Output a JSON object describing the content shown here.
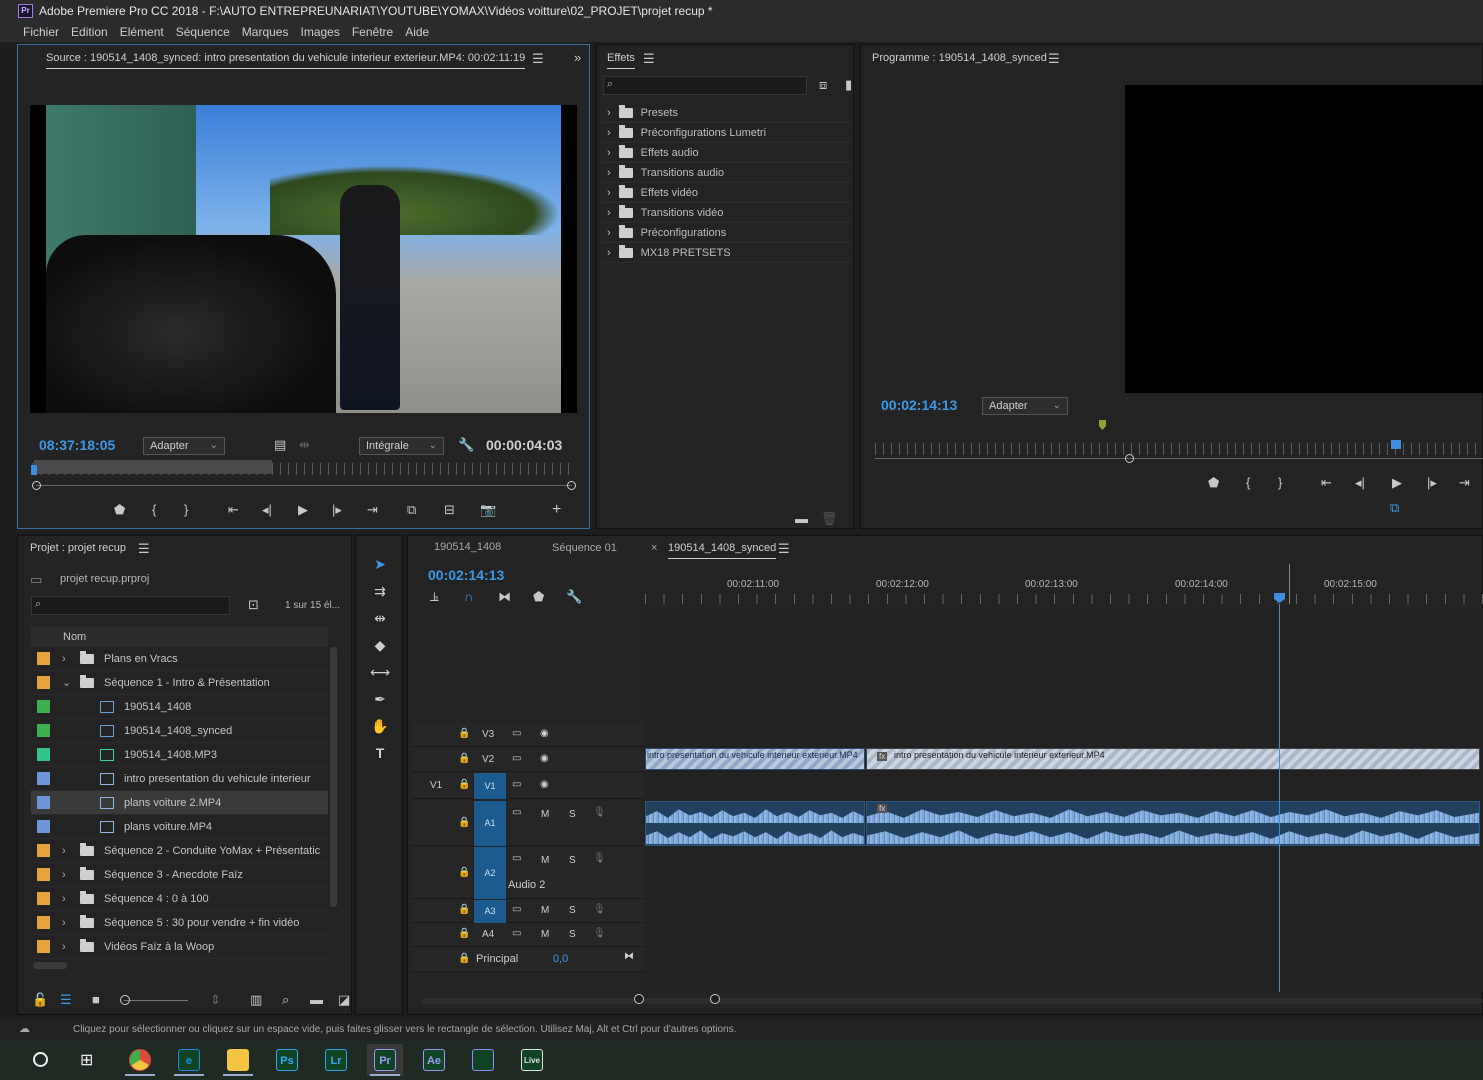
{
  "app": {
    "title": "Adobe Premiere Pro CC 2018 - F:\\AUTO ENTREPREUNARIAT\\YOUTUBE\\YOMAX\\Vidéos voitture\\02_PROJET\\projet recup *",
    "logo": "Pr"
  },
  "menu": [
    "Fichier",
    "Edition",
    "Elément",
    "Séquence",
    "Marques",
    "Images",
    "Fenêtre",
    "Aide"
  ],
  "source": {
    "title": "Source : 190514_1408_synced: intro  presentation du vehicule interieur exterieur.MP4: 00:02:11:19",
    "timecode": "08:37:18:05",
    "fit": "Adapter",
    "quality": "Intégrale",
    "duration": "00:00:04:03"
  },
  "effects": {
    "title": "Effets",
    "search_placeholder": "",
    "items": [
      "Presets",
      "Préconfigurations Lumetri",
      "Effets audio",
      "Transitions audio",
      "Effets vidéo",
      "Transitions vidéo",
      "Préconfigurations",
      "MX18 PRETSETS"
    ]
  },
  "program": {
    "title": "Programme : 190514_1408_synced",
    "timecode": "00:02:14:13",
    "fit": "Adapter"
  },
  "project": {
    "title": "Projet : projet recup",
    "file": "projet recup.prproj",
    "count": "1 sur 15 él...",
    "col_name": "Nom",
    "rows": [
      {
        "label": "Plans en Vracs",
        "color": "#e8a33c",
        "type": "folder",
        "expand": "›",
        "indent": 0
      },
      {
        "label": "Séquence 1 - Intro & Présentation",
        "color": "#e8a33c",
        "type": "folder",
        "expand": "⌄",
        "indent": 0
      },
      {
        "label": "190514_1408",
        "color": "#3cb04e",
        "type": "seq",
        "expand": "",
        "indent": 1
      },
      {
        "label": "190514_1408_synced",
        "color": "#3cb04e",
        "type": "seq",
        "expand": "",
        "indent": 1
      },
      {
        "label": "190514_1408.MP3",
        "color": "#2fc489",
        "type": "audio",
        "expand": "",
        "indent": 1
      },
      {
        "label": "intro   presentation du vehicule interieur",
        "color": "#6d96d8",
        "type": "video",
        "expand": "",
        "indent": 1
      },
      {
        "label": "plans voiture 2.MP4",
        "color": "#6d96d8",
        "type": "video",
        "expand": "",
        "indent": 1,
        "selected": true
      },
      {
        "label": "plans voiture.MP4",
        "color": "#6d96d8",
        "type": "video",
        "expand": "",
        "indent": 1
      },
      {
        "label": "Séquence 2  - Conduite YoMax + Présentatic",
        "color": "#e8a33c",
        "type": "folder",
        "expand": "›",
        "indent": 0
      },
      {
        "label": "Séquence 3 - Anecdote Faïz",
        "color": "#e8a33c",
        "type": "folder",
        "expand": "›",
        "indent": 0
      },
      {
        "label": "Séquence 4 : 0 à 100",
        "color": "#e8a33c",
        "type": "folder",
        "expand": "›",
        "indent": 0
      },
      {
        "label": "Séquence 5 : 30 pour vendre + fin vidéo",
        "color": "#e8a33c",
        "type": "folder",
        "expand": "›",
        "indent": 0
      },
      {
        "label": "Vidéos Faïz à la Woop",
        "color": "#e8a33c",
        "type": "folder",
        "expand": "›",
        "indent": 0
      }
    ]
  },
  "timeline": {
    "tabs": [
      "190514_1408",
      "Séquence 01",
      "190514_1408_synced"
    ],
    "close": "×",
    "timecode": "00:02:14:13",
    "ruler": [
      "00:02:11:00",
      "00:02:12:00",
      "00:02:13:00",
      "00:02:14:00",
      "00:02:15:00"
    ],
    "tracks": {
      "v3": "V3",
      "v2": "V2",
      "v1": "V1",
      "v1src": "V1",
      "a1": "A1",
      "a2": "A2",
      "a3": "A3",
      "a4": "A4",
      "audio2": "Audio 2",
      "principal": "Principal",
      "principal_val": "0,0",
      "m": "M",
      "s": "S"
    },
    "clip1": "intro   presentation du vehicule interieur exterieur.MP4",
    "clip2": "intro   presentation du vehicule interieur exterieur.MP4",
    "fx": "fx"
  },
  "status": "Cliquez pour sélectionner ou cliquez sur un espace vide, puis faites glisser vers le rectangle de sélection. Utilisez Maj, Alt et Ctrl pour d'autres options.",
  "taskbar": [
    {
      "name": "chrome",
      "label": "",
      "color": "#dd4b39"
    },
    {
      "name": "edge",
      "label": "e",
      "color": "#1e88e5"
    },
    {
      "name": "explorer",
      "label": "",
      "color": "#f4c542"
    },
    {
      "name": "photoshop",
      "label": "Ps",
      "color": "#31a8ff"
    },
    {
      "name": "lightroom",
      "label": "Lr",
      "color": "#31a8ff"
    },
    {
      "name": "premiere",
      "label": "Pr",
      "color": "#9999ff"
    },
    {
      "name": "aftereffects",
      "label": "Ae",
      "color": "#9999ff"
    },
    {
      "name": "mediaencoder",
      "label": "",
      "color": "#8d8dff"
    },
    {
      "name": "live",
      "label": "Live",
      "color": "#e0e0e0"
    }
  ]
}
